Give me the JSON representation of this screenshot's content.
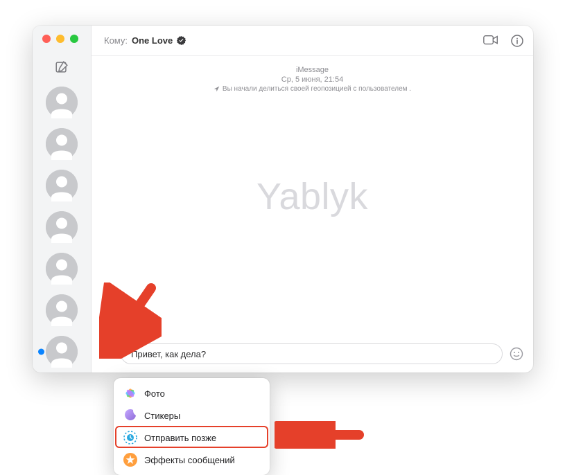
{
  "header": {
    "to_label": "Кому:",
    "contact_name": "One Love"
  },
  "conversation": {
    "service": "iMessage",
    "date": "Ср, 5 июня, 21:54",
    "system_message": "Вы начали делиться своей геопозицией с пользователем ."
  },
  "compose": {
    "message_text": "Привет, как дела?"
  },
  "menu": {
    "photos": "Фото",
    "stickers": "Стикеры",
    "send_later": "Отправить позже",
    "message_effects": "Эффекты сообщений"
  },
  "watermark": "Yablyk",
  "sidebar": {
    "conversations_count": 7,
    "active_index": 6
  }
}
